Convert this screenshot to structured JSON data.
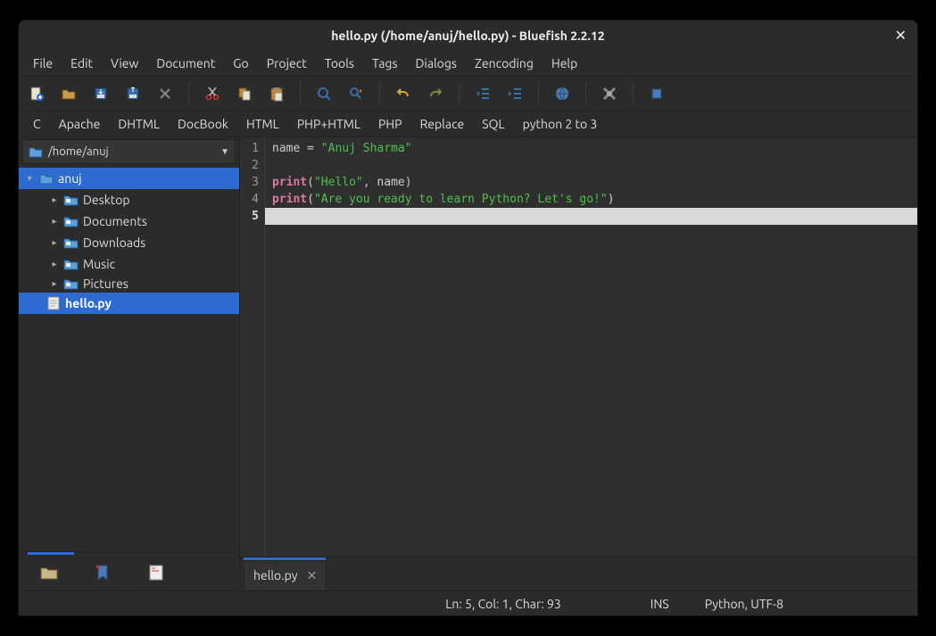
{
  "title": "hello.py (/home/anuj/hello.py) - Bluefish 2.2.12",
  "menubar": [
    "File",
    "Edit",
    "View",
    "Document",
    "Go",
    "Project",
    "Tools",
    "Tags",
    "Dialogs",
    "Zencoding",
    "Help"
  ],
  "langbar": [
    "C",
    "Apache",
    "DHTML",
    "DocBook",
    "HTML",
    "PHP+HTML",
    "PHP",
    "Replace",
    "SQL",
    "python 2 to 3"
  ],
  "path_selector": "/home/anuj",
  "tree": {
    "root": "anuj",
    "children": [
      "Desktop",
      "Documents",
      "Downloads",
      "Music",
      "Pictures"
    ],
    "selected_file": "hello.py"
  },
  "code": {
    "lines": [
      {
        "no": 1,
        "segments": [
          {
            "t": "name ",
            "c": "tok-name"
          },
          {
            "t": "= ",
            "c": "tok-op"
          },
          {
            "t": "\"Anuj Sharma\"",
            "c": "tok-str"
          }
        ]
      },
      {
        "no": 2,
        "segments": []
      },
      {
        "no": 3,
        "segments": [
          {
            "t": "print",
            "c": "tok-kw"
          },
          {
            "t": "(",
            "c": "tok-paren"
          },
          {
            "t": "\"Hello\"",
            "c": "tok-str"
          },
          {
            "t": ", ",
            "c": "tok-comma"
          },
          {
            "t": "name",
            "c": "tok-name"
          },
          {
            "t": ")",
            "c": "tok-paren"
          }
        ]
      },
      {
        "no": 4,
        "segments": [
          {
            "t": "print",
            "c": "tok-kw"
          },
          {
            "t": "(",
            "c": "tok-paren"
          },
          {
            "t": "\"Are you ready to learn Python? Let's go!\"",
            "c": "tok-str"
          },
          {
            "t": ")",
            "c": "tok-paren"
          }
        ]
      },
      {
        "no": 5,
        "segments": [],
        "current": true
      }
    ]
  },
  "tab": {
    "label": "hello.py"
  },
  "status": {
    "pos": "Ln: 5, Col: 1, Char: 93",
    "mode": "INS",
    "enc": "Python, UTF-8"
  }
}
